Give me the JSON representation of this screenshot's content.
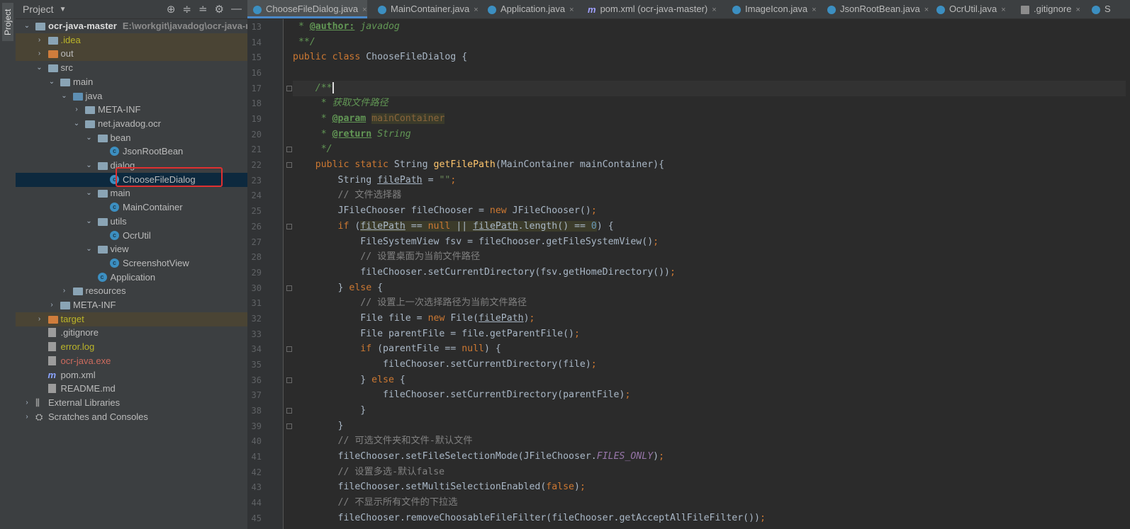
{
  "side_strip": {
    "label": "Project"
  },
  "project_panel": {
    "title": "Project",
    "tree": [
      {
        "label": "ocr-java-master",
        "extra": "E:\\workgit\\javadog\\ocr-java-mas",
        "depth": 0,
        "expanded": true,
        "icon": "module-folder-icon",
        "style": "bold"
      },
      {
        "label": ".idea",
        "depth": 1,
        "expanded": false,
        "icon": "folder-icon",
        "style": "gold",
        "highlight": true
      },
      {
        "label": "out",
        "depth": 1,
        "expanded": false,
        "icon": "excluded-folder-icon",
        "style": "normal",
        "highlight": true
      },
      {
        "label": "src",
        "depth": 1,
        "expanded": true,
        "icon": "folder-icon",
        "style": "normal"
      },
      {
        "label": "main",
        "depth": 2,
        "expanded": true,
        "icon": "folder-icon",
        "style": "normal"
      },
      {
        "label": "java",
        "depth": 3,
        "expanded": true,
        "icon": "source-folder-icon",
        "style": "normal"
      },
      {
        "label": "META-INF",
        "depth": 4,
        "expanded": false,
        "icon": "folder-icon",
        "style": "normal"
      },
      {
        "label": "net.javadog.ocr",
        "depth": 4,
        "expanded": true,
        "icon": "package-icon",
        "style": "normal"
      },
      {
        "label": "bean",
        "depth": 5,
        "expanded": true,
        "icon": "package-icon",
        "style": "normal"
      },
      {
        "label": "JsonRootBean",
        "depth": 6,
        "icon": "class-icon",
        "style": "normal"
      },
      {
        "label": "dialog",
        "depth": 5,
        "expanded": true,
        "icon": "package-icon",
        "style": "normal"
      },
      {
        "label": "ChooseFileDialog",
        "depth": 6,
        "icon": "class-icon",
        "style": "normal",
        "selected": true
      },
      {
        "label": "main",
        "depth": 5,
        "expanded": true,
        "icon": "package-icon",
        "style": "normal"
      },
      {
        "label": "MainContainer",
        "depth": 6,
        "icon": "class-icon",
        "style": "normal"
      },
      {
        "label": "utils",
        "depth": 5,
        "expanded": true,
        "icon": "package-icon",
        "style": "normal"
      },
      {
        "label": "OcrUtil",
        "depth": 6,
        "icon": "class-icon",
        "style": "normal"
      },
      {
        "label": "view",
        "depth": 5,
        "expanded": true,
        "icon": "package-icon",
        "style": "normal"
      },
      {
        "label": "ScreenshotView",
        "depth": 6,
        "icon": "class-icon",
        "style": "normal"
      },
      {
        "label": "Application",
        "depth": 5,
        "icon": "class-icon",
        "style": "normal"
      },
      {
        "label": "resources",
        "depth": 3,
        "expanded": false,
        "icon": "resources-folder-icon",
        "style": "normal"
      },
      {
        "label": "META-INF",
        "depth": 2,
        "expanded": false,
        "icon": "folder-icon",
        "style": "normal"
      },
      {
        "label": "target",
        "depth": 1,
        "expanded": false,
        "icon": "excluded-folder-icon",
        "style": "gold",
        "highlight": true
      },
      {
        "label": ".gitignore",
        "depth": 1,
        "icon": "gitignore-file-icon",
        "style": "normal"
      },
      {
        "label": "error.log",
        "depth": 1,
        "icon": "log-file-icon",
        "style": "gold"
      },
      {
        "label": "ocr-java.exe",
        "depth": 1,
        "icon": "exe-file-icon",
        "style": "red"
      },
      {
        "label": "pom.xml",
        "depth": 1,
        "icon": "maven-file-icon",
        "style": "normal"
      },
      {
        "label": "README.md",
        "depth": 1,
        "icon": "markdown-file-icon",
        "style": "normal"
      },
      {
        "label": "External Libraries",
        "depth": 0,
        "expanded": false,
        "icon": "libraries-icon",
        "style": "normal"
      },
      {
        "label": "Scratches and Consoles",
        "depth": 0,
        "expanded": false,
        "icon": "scratches-icon",
        "style": "normal"
      }
    ]
  },
  "tabs": [
    {
      "label": "ChooseFileDialog.java",
      "icon": "class-icon",
      "active": true
    },
    {
      "label": "MainContainer.java",
      "icon": "class-icon"
    },
    {
      "label": "Application.java",
      "icon": "class-icon"
    },
    {
      "label": "pom.xml (ocr-java-master)",
      "icon": "maven-file-icon"
    },
    {
      "label": "ImageIcon.java",
      "icon": "class-icon"
    },
    {
      "label": "JsonRootBean.java",
      "icon": "class-icon"
    },
    {
      "label": "OcrUtil.java",
      "icon": "class-icon"
    },
    {
      "label": ".gitignore",
      "icon": "gitignore-file-icon"
    },
    {
      "label": "S",
      "icon": "class-icon"
    }
  ],
  "editor": {
    "lines": [
      {
        "n": "13",
        "tokens": [
          {
            "t": " * ",
            "c": "doc"
          },
          {
            "t": "@author:",
            "c": "tag"
          },
          {
            "t": " javadog",
            "c": "doc"
          }
        ]
      },
      {
        "n": "14",
        "tokens": [
          {
            "t": " **/",
            "c": "doc"
          }
        ]
      },
      {
        "n": "15",
        "tokens": [
          {
            "t": "public class ",
            "c": "kw"
          },
          {
            "t": "ChooseFileDialog {",
            "c": ""
          }
        ]
      },
      {
        "n": "16",
        "tokens": []
      },
      {
        "n": "17",
        "current": true,
        "fold": true,
        "tokens": [
          {
            "t": "    /**",
            "c": "doc"
          },
          {
            "t": "",
            "c": "cursor"
          }
        ]
      },
      {
        "n": "18",
        "tokens": [
          {
            "t": "     * 获取文件路径",
            "c": "doc"
          }
        ]
      },
      {
        "n": "19",
        "tokens": [
          {
            "t": "     * ",
            "c": "doc"
          },
          {
            "t": "@param",
            "c": "tag"
          },
          {
            "t": " ",
            "c": "doc"
          },
          {
            "t": "mainContainer",
            "c": "param"
          }
        ]
      },
      {
        "n": "20",
        "tokens": [
          {
            "t": "     * ",
            "c": "doc"
          },
          {
            "t": "@return",
            "c": "tag"
          },
          {
            "t": " String",
            "c": "doc"
          }
        ]
      },
      {
        "n": "21",
        "fold": true,
        "tokens": [
          {
            "t": "     */",
            "c": "doc"
          }
        ]
      },
      {
        "n": "22",
        "fold": true,
        "tokens": [
          {
            "t": "    public static ",
            "c": "kw"
          },
          {
            "t": "String ",
            "c": ""
          },
          {
            "t": "getFilePath",
            "c": "fn"
          },
          {
            "t": "(MainContainer mainContainer){",
            "c": ""
          }
        ]
      },
      {
        "n": "23",
        "tokens": [
          {
            "t": "        String ",
            "c": ""
          },
          {
            "t": "filePath",
            "c": "ul"
          },
          {
            "t": " = ",
            "c": ""
          },
          {
            "t": "\"\"",
            "c": "str"
          },
          {
            "t": ";",
            "c": "kw"
          }
        ]
      },
      {
        "n": "24",
        "tokens": [
          {
            "t": "        // 文件选择器",
            "c": "cm"
          }
        ]
      },
      {
        "n": "25",
        "tokens": [
          {
            "t": "        JFileChooser fileChooser = ",
            "c": ""
          },
          {
            "t": "new ",
            "c": "kw"
          },
          {
            "t": "JFileChooser()",
            "c": ""
          },
          {
            "t": ";",
            "c": "kw"
          }
        ]
      },
      {
        "n": "26",
        "fold": true,
        "tokens": [
          {
            "t": "        ",
            "c": ""
          },
          {
            "t": "if ",
            "c": "kw"
          },
          {
            "t": "(",
            "c": ""
          },
          {
            "t": "filePath",
            "c": "ulw"
          },
          {
            "t": " == ",
            "c": "w"
          },
          {
            "t": "null",
            "c": "kww"
          },
          {
            "t": " || ",
            "c": "w"
          },
          {
            "t": "filePath",
            "c": "ulw"
          },
          {
            "t": ".length() == ",
            "c": "w"
          },
          {
            "t": "0",
            "c": "numw"
          },
          {
            "t": ") {",
            "c": ""
          }
        ]
      },
      {
        "n": "27",
        "tokens": [
          {
            "t": "            FileSystemView fsv = fileChooser.getFileSystemView()",
            "c": ""
          },
          {
            "t": ";",
            "c": "kw"
          }
        ]
      },
      {
        "n": "28",
        "tokens": [
          {
            "t": "            // 设置桌面为当前文件路径",
            "c": "cm"
          }
        ]
      },
      {
        "n": "29",
        "tokens": [
          {
            "t": "            fileChooser.setCurrentDirectory(fsv.getHomeDirectory())",
            "c": ""
          },
          {
            "t": ";",
            "c": "kw"
          }
        ]
      },
      {
        "n": "30",
        "fold": true,
        "tokens": [
          {
            "t": "        } ",
            "c": ""
          },
          {
            "t": "else ",
            "c": "kw"
          },
          {
            "t": "{",
            "c": ""
          }
        ]
      },
      {
        "n": "31",
        "tokens": [
          {
            "t": "            // 设置上一次选择路径为当前文件路径",
            "c": "cm"
          }
        ]
      },
      {
        "n": "32",
        "tokens": [
          {
            "t": "            File file = ",
            "c": ""
          },
          {
            "t": "new ",
            "c": "kw"
          },
          {
            "t": "File(",
            "c": ""
          },
          {
            "t": "filePath",
            "c": "ul"
          },
          {
            "t": ")",
            "c": ""
          },
          {
            "t": ";",
            "c": "kw"
          }
        ]
      },
      {
        "n": "33",
        "tokens": [
          {
            "t": "            File parentFile = file.getParentFile()",
            "c": ""
          },
          {
            "t": ";",
            "c": "kw"
          }
        ]
      },
      {
        "n": "34",
        "fold": true,
        "tokens": [
          {
            "t": "            ",
            "c": ""
          },
          {
            "t": "if ",
            "c": "kw"
          },
          {
            "t": "(parentFile == ",
            "c": ""
          },
          {
            "t": "null",
            "c": "kw"
          },
          {
            "t": ") {",
            "c": ""
          }
        ]
      },
      {
        "n": "35",
        "tokens": [
          {
            "t": "                fileChooser.setCurrentDirectory(file)",
            "c": ""
          },
          {
            "t": ";",
            "c": "kw"
          }
        ]
      },
      {
        "n": "36",
        "fold": true,
        "tokens": [
          {
            "t": "            } ",
            "c": ""
          },
          {
            "t": "else ",
            "c": "kw"
          },
          {
            "t": "{",
            "c": ""
          }
        ]
      },
      {
        "n": "37",
        "tokens": [
          {
            "t": "                fileChooser.setCurrentDirectory(parentFile)",
            "c": ""
          },
          {
            "t": ";",
            "c": "kw"
          }
        ]
      },
      {
        "n": "38",
        "fold": true,
        "tokens": [
          {
            "t": "            }",
            "c": ""
          }
        ]
      },
      {
        "n": "39",
        "fold": true,
        "tokens": [
          {
            "t": "        }",
            "c": ""
          }
        ]
      },
      {
        "n": "40",
        "tokens": [
          {
            "t": "        // 可选文件夹和文件-默认文件",
            "c": "cm"
          }
        ]
      },
      {
        "n": "41",
        "tokens": [
          {
            "t": "        fileChooser.setFileSelectionMode(JFileChooser.",
            "c": ""
          },
          {
            "t": "FILES_ONLY",
            "c": "cst"
          },
          {
            "t": ")",
            "c": ""
          },
          {
            "t": ";",
            "c": "kw"
          }
        ]
      },
      {
        "n": "42",
        "tokens": [
          {
            "t": "        // 设置多选-默认false",
            "c": "cm"
          }
        ]
      },
      {
        "n": "43",
        "tokens": [
          {
            "t": "        fileChooser.setMultiSelectionEnabled(",
            "c": ""
          },
          {
            "t": "false",
            "c": "kw"
          },
          {
            "t": ")",
            "c": ""
          },
          {
            "t": ";",
            "c": "kw"
          }
        ]
      },
      {
        "n": "44",
        "tokens": [
          {
            "t": "        // 不显示所有文件的下拉选",
            "c": "cm"
          }
        ]
      },
      {
        "n": "45",
        "tokens": [
          {
            "t": "        fileChooser.removeChoosableFileFilter(fileChooser.getAcceptAllFileFilter())",
            "c": ""
          },
          {
            "t": ";",
            "c": "kw"
          }
        ]
      }
    ]
  }
}
